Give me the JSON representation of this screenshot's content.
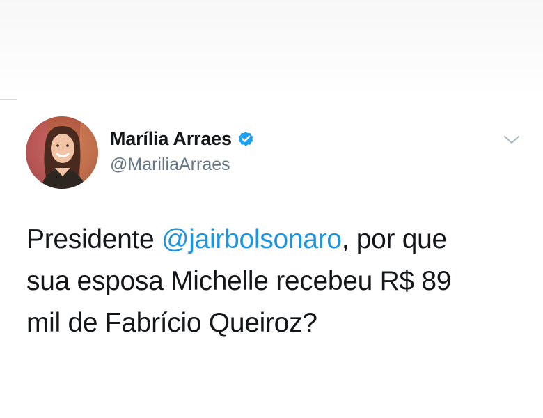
{
  "author": {
    "display_name": "Marília Arraes",
    "handle": "@MariliaArraes",
    "verified": true,
    "avatar_icon": "profile-photo"
  },
  "tweet": {
    "line1_before": "Presidente ",
    "mention": "@jairbolsonaro",
    "line1_after": ", por que",
    "line2": "sua esposa Michelle recebeu R$ 89",
    "line3": "mil de Fabrício Queiroz?"
  },
  "icons": {
    "verified": "verified-badge-icon",
    "menu": "chevron-down-icon"
  },
  "colors": {
    "text": "#14171a",
    "secondary": "#657786",
    "link": "#1b95e0",
    "verified": "#1da1f2"
  }
}
